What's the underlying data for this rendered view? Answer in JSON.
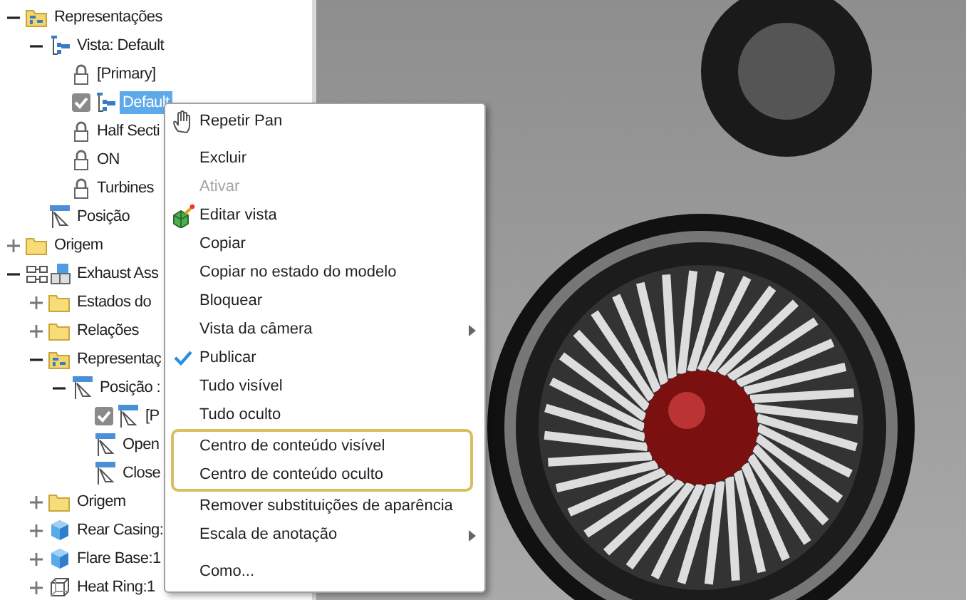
{
  "tree": [
    {
      "label": "Representações",
      "kind": "rep-folder",
      "expanded": true,
      "selected": false,
      "children": [
        {
          "label": "Vista: Default",
          "kind": "view",
          "expanded": true,
          "selected": false,
          "children": [
            {
              "label": "[Primary]",
              "kind": "lock",
              "selected": false
            },
            {
              "label": "Default",
              "kind": "view",
              "checked": true,
              "selected": true
            },
            {
              "label": "Half Secti",
              "kind": "lock",
              "selected": false
            },
            {
              "label": "ON",
              "kind": "lock",
              "selected": false
            },
            {
              "label": "Turbines",
              "kind": "lock",
              "selected": false
            }
          ]
        },
        {
          "label": "Posição",
          "kind": "position",
          "selected": false
        }
      ]
    },
    {
      "label": "Origem",
      "kind": "folder",
      "expanded": false,
      "selected": false
    },
    {
      "label": "Exhaust Ass",
      "kind": "assembly",
      "expanded": true,
      "selected": false,
      "children": [
        {
          "label": "Estados do",
          "kind": "folder",
          "expanded": false,
          "selected": false
        },
        {
          "label": "Relações",
          "kind": "folder",
          "expanded": false,
          "selected": false
        },
        {
          "label": "Representaç",
          "kind": "rep-folder",
          "expanded": true,
          "selected": false,
          "children": [
            {
              "label": "Posição :",
              "kind": "position",
              "expanded": true,
              "selected": false,
              "children": [
                {
                  "label": "[P",
                  "kind": "position",
                  "checked": true,
                  "selected": false
                },
                {
                  "label": "Open",
                  "kind": "position",
                  "selected": false
                },
                {
                  "label": "Close",
                  "kind": "position",
                  "selected": false
                }
              ]
            }
          ]
        },
        {
          "label": "Origem",
          "kind": "folder",
          "expanded": false,
          "selected": false
        },
        {
          "label": "Rear Casing:",
          "kind": "part",
          "expanded": false,
          "selected": false
        },
        {
          "label": "Flare Base:1",
          "kind": "part",
          "expanded": false,
          "selected": false
        },
        {
          "label": "Heat Ring:1",
          "kind": "wire-part",
          "expanded": false,
          "selected": false
        }
      ]
    }
  ],
  "context_menu": {
    "items": [
      {
        "label": "Repetir Pan",
        "kind": "hand",
        "disabled": false,
        "checked": false,
        "submenu": false,
        "highlighted": false,
        "gap_before": false
      },
      {
        "label": "Excluir",
        "disabled": false,
        "checked": false,
        "submenu": false,
        "highlighted": false,
        "gap_before": true
      },
      {
        "label": "Ativar",
        "disabled": true,
        "checked": false,
        "submenu": false,
        "highlighted": false,
        "gap_before": false
      },
      {
        "label": "Editar vista",
        "kind": "edit",
        "disabled": false,
        "checked": false,
        "submenu": false,
        "highlighted": false,
        "gap_before": false
      },
      {
        "label": "Copiar",
        "disabled": false,
        "checked": false,
        "submenu": false,
        "highlighted": false,
        "gap_before": false
      },
      {
        "label": "Copiar no estado do modelo",
        "disabled": false,
        "checked": false,
        "submenu": false,
        "highlighted": false,
        "gap_before": false
      },
      {
        "label": "Bloquear",
        "disabled": false,
        "checked": false,
        "submenu": false,
        "highlighted": false,
        "gap_before": false
      },
      {
        "label": "Vista da câmera",
        "disabled": false,
        "checked": false,
        "submenu": true,
        "highlighted": false,
        "gap_before": false
      },
      {
        "label": "Publicar",
        "disabled": false,
        "checked": true,
        "submenu": false,
        "highlighted": false,
        "gap_before": false
      },
      {
        "label": "Tudo visível",
        "disabled": false,
        "checked": false,
        "submenu": false,
        "highlighted": false,
        "gap_before": false
      },
      {
        "label": "Tudo oculto",
        "disabled": false,
        "checked": false,
        "submenu": false,
        "highlighted": false,
        "gap_before": false
      },
      {
        "label": "Centro de conteúdo visível",
        "disabled": false,
        "checked": false,
        "submenu": false,
        "highlighted": true,
        "gap_before": false
      },
      {
        "label": "Centro de conteúdo oculto",
        "disabled": false,
        "checked": false,
        "submenu": false,
        "highlighted": true,
        "gap_before": false
      },
      {
        "label": "Remover substituições de aparência",
        "disabled": false,
        "checked": false,
        "submenu": false,
        "highlighted": false,
        "gap_before": false
      },
      {
        "label": "Escala de anotação",
        "disabled": false,
        "checked": false,
        "submenu": true,
        "highlighted": false,
        "gap_before": false
      },
      {
        "label": "Como...",
        "disabled": false,
        "checked": false,
        "submenu": false,
        "highlighted": false,
        "gap_before": true
      }
    ]
  }
}
